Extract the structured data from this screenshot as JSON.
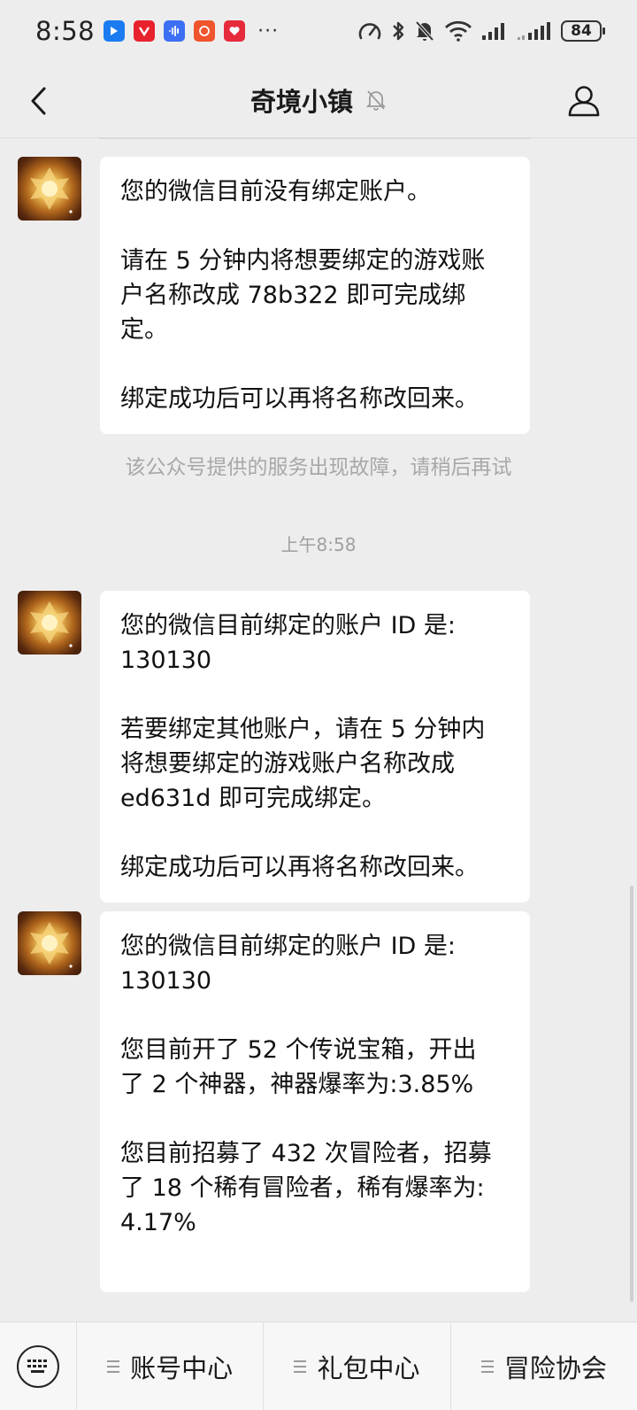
{
  "status": {
    "time": "8:58",
    "battery": "84",
    "more": "···"
  },
  "nav": {
    "title": "奇境小镇"
  },
  "messages": [
    {
      "paragraphs": [
        "您的微信目前没有绑定账户。",
        "请在 5 分钟内将想要绑定的游戏账\n户名称改成 78b322 即可完成绑\n定。",
        "绑定成功后可以再将名称改回来。"
      ]
    },
    {
      "paragraphs": [
        "您的微信目前绑定的账户 ID 是:\n130130",
        "若要绑定其他账户，请在 5 分钟内\n将想要绑定的游戏账户名称改成\ned631d 即可完成绑定。",
        "绑定成功后可以再将名称改回来。"
      ]
    },
    {
      "paragraphs": [
        "您的微信目前绑定的账户 ID 是:\n130130",
        "您目前开了 52 个传说宝箱，开出\n了 2 个神器，神器爆率为:3.85%",
        "您目前招募了 432 次冒险者，招募\n了 18 个稀有冒险者，稀有爆率为:\n4.17%"
      ]
    }
  ],
  "system_notice": "该公众号提供的服务出现故障，请稍后再试",
  "timestamp": "上午8:58",
  "menu": {
    "items": [
      {
        "label": "账号中心"
      },
      {
        "label": "礼包中心"
      },
      {
        "label": "冒险协会"
      }
    ]
  }
}
